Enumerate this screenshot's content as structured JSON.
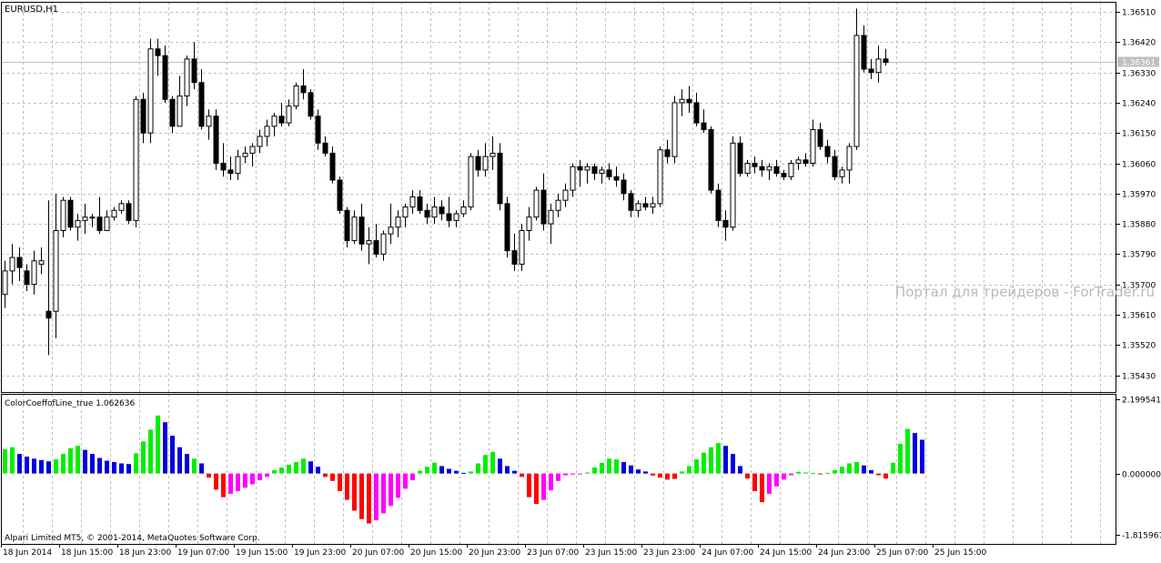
{
  "symbol_label": "EURUSD,H1",
  "indicator_label": "ColorCoeffofLine_true 1.062636",
  "copyright": "Alpari Limited MT5, © 2001-2014, MetaQuotes Software Corp.",
  "watermark": "Портал для трейдеров - ForTrader.ru",
  "colors": {
    "grid": "#c0c0c0",
    "candle_up": "#ffffff",
    "candle_down": "#000000",
    "hist_lime": "#00ee00",
    "hist_blue": "#0000e0",
    "hist_red": "#ff0000",
    "hist_magenta": "#ff00ff"
  },
  "chart_data": [
    {
      "type": "candlestick",
      "ylim": [
        1.3538,
        1.3654
      ],
      "price_ticks": [
        "1.36510",
        "1.36420",
        "1.36330",
        "1.36240",
        "1.36150",
        "1.36060",
        "1.35970",
        "1.35880",
        "1.35790",
        "1.35700",
        "1.35610",
        "1.35520",
        "1.35430"
      ],
      "current_price_label": "1.36361",
      "current_price": 1.36361,
      "x_labels": [
        "18 Jun 2014",
        "18 Jun 15:00",
        "18 Jun 23:00",
        "19 Jun 07:00",
        "19 Jun 15:00",
        "19 Jun 23:00",
        "20 Jun 07:00",
        "20 Jun 15:00",
        "20 Jun 23:00",
        "23 Jun 07:00",
        "23 Jun 15:00",
        "23 Jun 23:00",
        "24 Jun 07:00",
        "24 Jun 15:00",
        "24 Jun 23:00",
        "25 Jun 07:00",
        "25 Jun 15:00"
      ],
      "candles": [
        [
          1.3567,
          1.3577,
          1.3563,
          1.3574
        ],
        [
          1.3574,
          1.3582,
          1.357,
          1.3578
        ],
        [
          1.3578,
          1.3581,
          1.3571,
          1.3575
        ],
        [
          1.3574,
          1.3576,
          1.3568,
          1.357
        ],
        [
          1.357,
          1.358,
          1.3567,
          1.3577
        ],
        [
          1.3576,
          1.3581,
          1.3573,
          1.3577
        ],
        [
          1.3562,
          1.3595,
          1.3549,
          1.356
        ],
        [
          1.3562,
          1.3597,
          1.3554,
          1.3586
        ],
        [
          1.3586,
          1.3596,
          1.3584,
          1.3595
        ],
        [
          1.3595,
          1.3596,
          1.3586,
          1.3587
        ],
        [
          1.3587,
          1.3591,
          1.3583,
          1.3589
        ],
        [
          1.3589,
          1.3594,
          1.3585,
          1.359
        ],
        [
          1.359,
          1.3591,
          1.3587,
          1.359
        ],
        [
          1.359,
          1.3596,
          1.3585,
          1.3586
        ],
        [
          1.3586,
          1.3592,
          1.3586,
          1.359
        ],
        [
          1.359,
          1.3593,
          1.3589,
          1.3592
        ],
        [
          1.3592,
          1.3595,
          1.3591,
          1.3594
        ],
        [
          1.3594,
          1.3595,
          1.3588,
          1.3589
        ],
        [
          1.3589,
          1.3626,
          1.3587,
          1.3625
        ],
        [
          1.3625,
          1.3627,
          1.3612,
          1.3615
        ],
        [
          1.3615,
          1.3643,
          1.3612,
          1.364
        ],
        [
          1.364,
          1.3643,
          1.3632,
          1.3638
        ],
        [
          1.3638,
          1.3641,
          1.3624,
          1.3625
        ],
        [
          1.3625,
          1.3626,
          1.3615,
          1.3617
        ],
        [
          1.3617,
          1.3632,
          1.3617,
          1.3626
        ],
        [
          1.3626,
          1.3638,
          1.3623,
          1.3637
        ],
        [
          1.3637,
          1.3642,
          1.3628,
          1.363
        ],
        [
          1.363,
          1.3634,
          1.3616,
          1.3617
        ],
        [
          1.3617,
          1.3622,
          1.3613,
          1.362
        ],
        [
          1.362,
          1.3622,
          1.3604,
          1.3606
        ],
        [
          1.3606,
          1.3612,
          1.3602,
          1.3604
        ],
        [
          1.3604,
          1.3608,
          1.3601,
          1.3603
        ],
        [
          1.3603,
          1.361,
          1.3601,
          1.3608
        ],
        [
          1.3608,
          1.3611,
          1.3606,
          1.3609
        ],
        [
          1.3609,
          1.3612,
          1.3605,
          1.3611
        ],
        [
          1.3611,
          1.3616,
          1.3609,
          1.3614
        ],
        [
          1.3614,
          1.3619,
          1.3611,
          1.3617
        ],
        [
          1.3617,
          1.3621,
          1.3614,
          1.362
        ],
        [
          1.362,
          1.3624,
          1.3617,
          1.3618
        ],
        [
          1.3618,
          1.3625,
          1.3617,
          1.3623
        ],
        [
          1.3623,
          1.363,
          1.3622,
          1.3629
        ],
        [
          1.3629,
          1.3634,
          1.3625,
          1.3627
        ],
        [
          1.3627,
          1.3628,
          1.3619,
          1.362
        ],
        [
          1.362,
          1.3622,
          1.361,
          1.3612
        ],
        [
          1.3612,
          1.3614,
          1.3608,
          1.3609
        ],
        [
          1.3609,
          1.3611,
          1.36,
          1.3601
        ],
        [
          1.3601,
          1.3602,
          1.3591,
          1.3592
        ],
        [
          1.3592,
          1.3593,
          1.3581,
          1.3583
        ],
        [
          1.3583,
          1.3592,
          1.3582,
          1.359
        ],
        [
          1.359,
          1.3594,
          1.358,
          1.3582
        ],
        [
          1.3582,
          1.3587,
          1.3576,
          1.3583
        ],
        [
          1.3583,
          1.3588,
          1.3578,
          1.3579
        ],
        [
          1.3579,
          1.3586,
          1.3577,
          1.3585
        ],
        [
          1.3585,
          1.3594,
          1.3582,
          1.3587
        ],
        [
          1.3587,
          1.3592,
          1.3584,
          1.359
        ],
        [
          1.359,
          1.3594,
          1.3587,
          1.3593
        ],
        [
          1.3593,
          1.3598,
          1.3591,
          1.3596
        ],
        [
          1.3596,
          1.3598,
          1.3591,
          1.3592
        ],
        [
          1.3592,
          1.3594,
          1.3588,
          1.359
        ],
        [
          1.359,
          1.3596,
          1.3588,
          1.3593
        ],
        [
          1.3593,
          1.3595,
          1.3589,
          1.3591
        ],
        [
          1.3591,
          1.3596,
          1.3587,
          1.3589
        ],
        [
          1.3589,
          1.3592,
          1.3587,
          1.3591
        ],
        [
          1.3591,
          1.3595,
          1.359,
          1.3593
        ],
        [
          1.3593,
          1.3609,
          1.3592,
          1.3608
        ],
        [
          1.3608,
          1.361,
          1.3602,
          1.3604
        ],
        [
          1.3604,
          1.3612,
          1.3602,
          1.3608
        ],
        [
          1.3608,
          1.3614,
          1.3604,
          1.3609
        ],
        [
          1.3609,
          1.3612,
          1.3592,
          1.3594
        ],
        [
          1.3594,
          1.3596,
          1.3578,
          1.358
        ],
        [
          1.358,
          1.3585,
          1.3574,
          1.3576
        ],
        [
          1.3576,
          1.3588,
          1.3574,
          1.3586
        ],
        [
          1.3586,
          1.3593,
          1.3583,
          1.359
        ],
        [
          1.359,
          1.3599,
          1.3589,
          1.3598
        ],
        [
          1.3598,
          1.3603,
          1.3586,
          1.3588
        ],
        [
          1.3588,
          1.3594,
          1.3582,
          1.3592
        ],
        [
          1.3592,
          1.3597,
          1.359,
          1.3595
        ],
        [
          1.3595,
          1.36,
          1.3593,
          1.3598
        ],
        [
          1.3598,
          1.3606,
          1.3596,
          1.3605
        ],
        [
          1.3605,
          1.3607,
          1.3599,
          1.3604
        ],
        [
          1.3604,
          1.3606,
          1.36,
          1.3605
        ],
        [
          1.3605,
          1.3606,
          1.3601,
          1.3603
        ],
        [
          1.3603,
          1.3605,
          1.36,
          1.3604
        ],
        [
          1.3604,
          1.3606,
          1.3601,
          1.3602
        ],
        [
          1.3602,
          1.3605,
          1.3599,
          1.3601
        ],
        [
          1.3601,
          1.3603,
          1.3595,
          1.3597
        ],
        [
          1.3597,
          1.3598,
          1.359,
          1.3592
        ],
        [
          1.3592,
          1.3595,
          1.359,
          1.3594
        ],
        [
          1.3594,
          1.3596,
          1.3592,
          1.3593
        ],
        [
          1.3593,
          1.3596,
          1.3591,
          1.3594
        ],
        [
          1.3594,
          1.3611,
          1.3593,
          1.361
        ],
        [
          1.361,
          1.3613,
          1.3606,
          1.3608
        ],
        [
          1.3608,
          1.3626,
          1.3606,
          1.3624
        ],
        [
          1.3624,
          1.3628,
          1.362,
          1.3625
        ],
        [
          1.3625,
          1.3629,
          1.3621,
          1.3624
        ],
        [
          1.3624,
          1.3627,
          1.3617,
          1.3618
        ],
        [
          1.3618,
          1.3622,
          1.3615,
          1.3616
        ],
        [
          1.3616,
          1.3617,
          1.3597,
          1.3598
        ],
        [
          1.3598,
          1.36,
          1.3587,
          1.3589
        ],
        [
          1.3589,
          1.3592,
          1.3583,
          1.3587
        ],
        [
          1.3587,
          1.3614,
          1.3586,
          1.3612
        ],
        [
          1.3612,
          1.3614,
          1.3602,
          1.3603
        ],
        [
          1.3603,
          1.3607,
          1.3602,
          1.3606
        ],
        [
          1.3606,
          1.3608,
          1.3603,
          1.3605
        ],
        [
          1.3605,
          1.3607,
          1.3602,
          1.3604
        ],
        [
          1.3604,
          1.3606,
          1.3601,
          1.3605
        ],
        [
          1.3605,
          1.3607,
          1.3602,
          1.3603
        ],
        [
          1.3603,
          1.3604,
          1.3601,
          1.3602
        ],
        [
          1.3602,
          1.3607,
          1.3601,
          1.3606
        ],
        [
          1.3606,
          1.3608,
          1.3604,
          1.3607
        ],
        [
          1.3607,
          1.3609,
          1.3605,
          1.3606
        ],
        [
          1.3606,
          1.3619,
          1.3605,
          1.3616
        ],
        [
          1.3616,
          1.3618,
          1.361,
          1.3611
        ],
        [
          1.3611,
          1.3613,
          1.3606,
          1.3608
        ],
        [
          1.3608,
          1.361,
          1.3601,
          1.3602
        ],
        [
          1.3602,
          1.3605,
          1.36,
          1.3604
        ],
        [
          1.3604,
          1.3612,
          1.36,
          1.3611
        ],
        [
          1.3611,
          1.3652,
          1.361,
          1.3644
        ],
        [
          1.3644,
          1.3647,
          1.3633,
          1.3634
        ],
        [
          1.3634,
          1.3637,
          1.3631,
          1.3633
        ],
        [
          1.3633,
          1.3641,
          1.363,
          1.3637
        ],
        [
          1.3637,
          1.364,
          1.3635,
          1.3636
        ]
      ]
    },
    {
      "type": "histogram",
      "title": "ColorCoeffofLine_true 1.062636",
      "ylim": [
        -1.815967,
        2.199541
      ],
      "y_ticks": [
        "2.199541",
        "0.000000",
        "-1.815967"
      ],
      "bars": [
        [
          0.72,
          "lime"
        ],
        [
          0.78,
          "lime"
        ],
        [
          0.58,
          "blue"
        ],
        [
          0.5,
          "blue"
        ],
        [
          0.44,
          "blue"
        ],
        [
          0.4,
          "blue"
        ],
        [
          0.36,
          "blue"
        ],
        [
          0.42,
          "lime"
        ],
        [
          0.58,
          "lime"
        ],
        [
          0.75,
          "lime"
        ],
        [
          0.82,
          "lime"
        ],
        [
          0.7,
          "blue"
        ],
        [
          0.58,
          "blue"
        ],
        [
          0.46,
          "blue"
        ],
        [
          0.38,
          "blue"
        ],
        [
          0.34,
          "blue"
        ],
        [
          0.3,
          "blue"
        ],
        [
          0.28,
          "blue"
        ],
        [
          0.6,
          "lime"
        ],
        [
          0.95,
          "lime"
        ],
        [
          1.3,
          "lime"
        ],
        [
          1.72,
          "lime"
        ],
        [
          1.52,
          "blue"
        ],
        [
          1.12,
          "blue"
        ],
        [
          0.78,
          "blue"
        ],
        [
          0.58,
          "blue"
        ],
        [
          0.44,
          "lime"
        ],
        [
          0.3,
          "blue"
        ],
        [
          -0.12,
          "red"
        ],
        [
          -0.48,
          "red"
        ],
        [
          -0.7,
          "red"
        ],
        [
          -0.6,
          "magenta"
        ],
        [
          -0.52,
          "magenta"
        ],
        [
          -0.42,
          "magenta"
        ],
        [
          -0.32,
          "magenta"
        ],
        [
          -0.2,
          "magenta"
        ],
        [
          -0.1,
          "magenta"
        ],
        [
          0.1,
          "lime"
        ],
        [
          0.18,
          "lime"
        ],
        [
          0.26,
          "lime"
        ],
        [
          0.34,
          "lime"
        ],
        [
          0.44,
          "lime"
        ],
        [
          0.36,
          "blue"
        ],
        [
          0.2,
          "blue"
        ],
        [
          -0.1,
          "red"
        ],
        [
          -0.22,
          "red"
        ],
        [
          -0.52,
          "red"
        ],
        [
          -0.78,
          "red"
        ],
        [
          -1.1,
          "red"
        ],
        [
          -1.35,
          "red"
        ],
        [
          -1.48,
          "red"
        ],
        [
          -1.38,
          "magenta"
        ],
        [
          -1.18,
          "magenta"
        ],
        [
          -0.96,
          "magenta"
        ],
        [
          -0.72,
          "magenta"
        ],
        [
          -0.45,
          "magenta"
        ],
        [
          -0.2,
          "magenta"
        ],
        [
          0.08,
          "lime"
        ],
        [
          0.2,
          "lime"
        ],
        [
          0.32,
          "lime"
        ],
        [
          0.22,
          "blue"
        ],
        [
          0.14,
          "blue"
        ],
        [
          0.08,
          "blue"
        ],
        [
          0.02,
          "blue"
        ],
        [
          0.06,
          "lime"
        ],
        [
          0.3,
          "lime"
        ],
        [
          0.55,
          "lime"
        ],
        [
          0.64,
          "lime"
        ],
        [
          0.44,
          "blue"
        ],
        [
          0.22,
          "blue"
        ],
        [
          0.08,
          "blue"
        ],
        [
          -0.1,
          "red"
        ],
        [
          -0.7,
          "red"
        ],
        [
          -0.9,
          "red"
        ],
        [
          -0.78,
          "magenta"
        ],
        [
          -0.5,
          "magenta"
        ],
        [
          -0.22,
          "magenta"
        ],
        [
          -0.05,
          "magenta"
        ],
        [
          -0.03,
          "magenta"
        ],
        [
          -0.02,
          "magenta"
        ],
        [
          0.03,
          "lime"
        ],
        [
          0.18,
          "lime"
        ],
        [
          0.32,
          "lime"
        ],
        [
          0.44,
          "lime"
        ],
        [
          0.42,
          "lime"
        ],
        [
          0.34,
          "blue"
        ],
        [
          0.24,
          "blue"
        ],
        [
          0.12,
          "blue"
        ],
        [
          0.06,
          "blue"
        ],
        [
          -0.06,
          "red"
        ],
        [
          -0.12,
          "red"
        ],
        [
          -0.18,
          "red"
        ],
        [
          -0.16,
          "red"
        ],
        [
          0.06,
          "lime"
        ],
        [
          0.22,
          "lime"
        ],
        [
          0.42,
          "lime"
        ],
        [
          0.62,
          "lime"
        ],
        [
          0.78,
          "lime"
        ],
        [
          0.9,
          "lime"
        ],
        [
          0.82,
          "blue"
        ],
        [
          0.58,
          "blue"
        ],
        [
          0.22,
          "blue"
        ],
        [
          -0.15,
          "red"
        ],
        [
          -0.52,
          "red"
        ],
        [
          -0.85,
          "red"
        ],
        [
          -0.6,
          "magenta"
        ],
        [
          -0.38,
          "magenta"
        ],
        [
          -0.18,
          "magenta"
        ],
        [
          -0.05,
          "magenta"
        ],
        [
          0.05,
          "lime"
        ],
        [
          0.03,
          "lime"
        ],
        [
          0.02,
          "lime"
        ],
        [
          -0.02,
          "red"
        ],
        [
          0.02,
          "lime"
        ],
        [
          0.1,
          "lime"
        ],
        [
          0.2,
          "lime"
        ],
        [
          0.3,
          "lime"
        ],
        [
          0.34,
          "lime"
        ],
        [
          0.24,
          "blue"
        ],
        [
          0.1,
          "blue"
        ],
        [
          -0.05,
          "red"
        ],
        [
          -0.15,
          "red"
        ],
        [
          0.32,
          "lime"
        ],
        [
          0.88,
          "lime"
        ],
        [
          1.32,
          "lime"
        ],
        [
          1.2,
          "blue"
        ],
        [
          1.0,
          "blue"
        ]
      ]
    }
  ]
}
